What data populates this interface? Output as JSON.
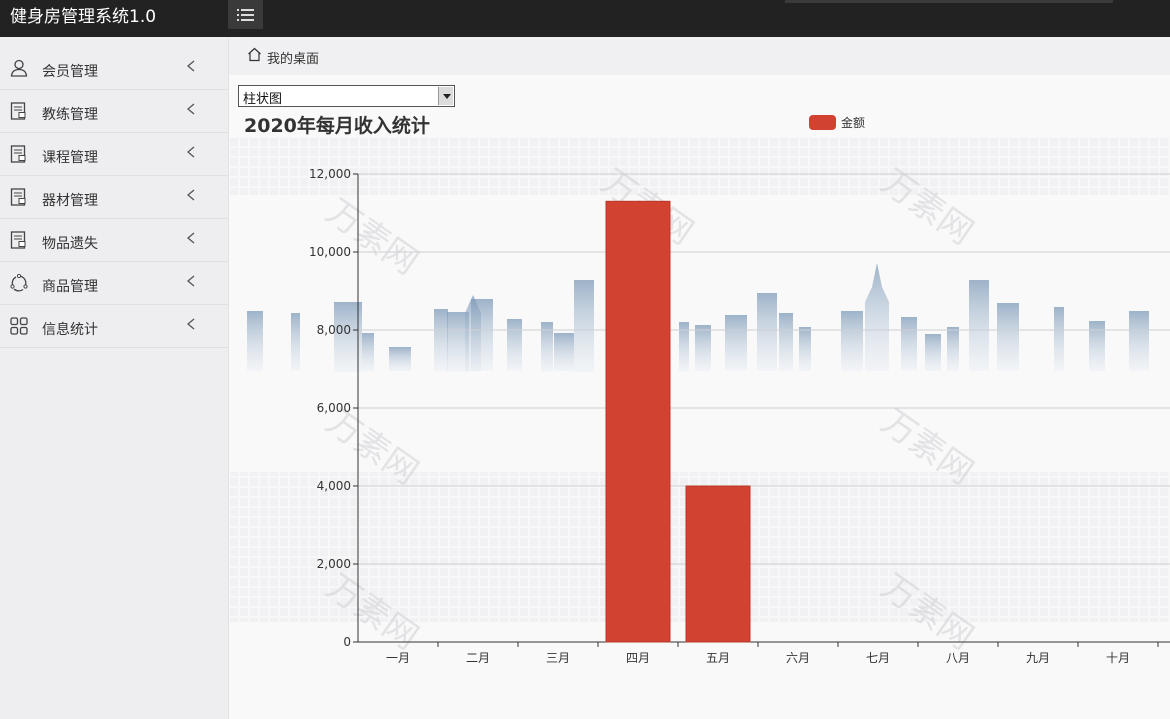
{
  "app": {
    "title": "健身房管理系统1.0"
  },
  "sidebar": {
    "items": [
      {
        "label": "会员管理",
        "icon": "user-icon"
      },
      {
        "label": "教练管理",
        "icon": "document-icon"
      },
      {
        "label": "课程管理",
        "icon": "document-icon"
      },
      {
        "label": "器材管理",
        "icon": "document-icon"
      },
      {
        "label": "物品遗失",
        "icon": "document-icon"
      },
      {
        "label": "商品管理",
        "icon": "share-icon"
      },
      {
        "label": "信息统计",
        "icon": "grid-icon"
      }
    ]
  },
  "breadcrumb": {
    "label": "我的桌面"
  },
  "chart_select": {
    "value": "柱状图"
  },
  "colors": {
    "bar": "#d14330",
    "topbar": "#222222"
  },
  "chart_data": {
    "type": "bar",
    "title": "2020年每月收入统计",
    "legend": [
      "金额"
    ],
    "legend_position": "top-right",
    "categories": [
      "一月",
      "二月",
      "三月",
      "四月",
      "五月",
      "六月",
      "七月",
      "八月",
      "九月",
      "十月"
    ],
    "series": [
      {
        "name": "金额",
        "values": [
          0,
          0,
          0,
          11300,
          4000,
          0,
          0,
          0,
          0,
          0
        ]
      }
    ],
    "ylim": [
      0,
      12000
    ],
    "yticks": [
      "0",
      "2,000",
      "4,000",
      "6,000",
      "8,000",
      "10,000",
      "12,000"
    ],
    "grid": true
  }
}
